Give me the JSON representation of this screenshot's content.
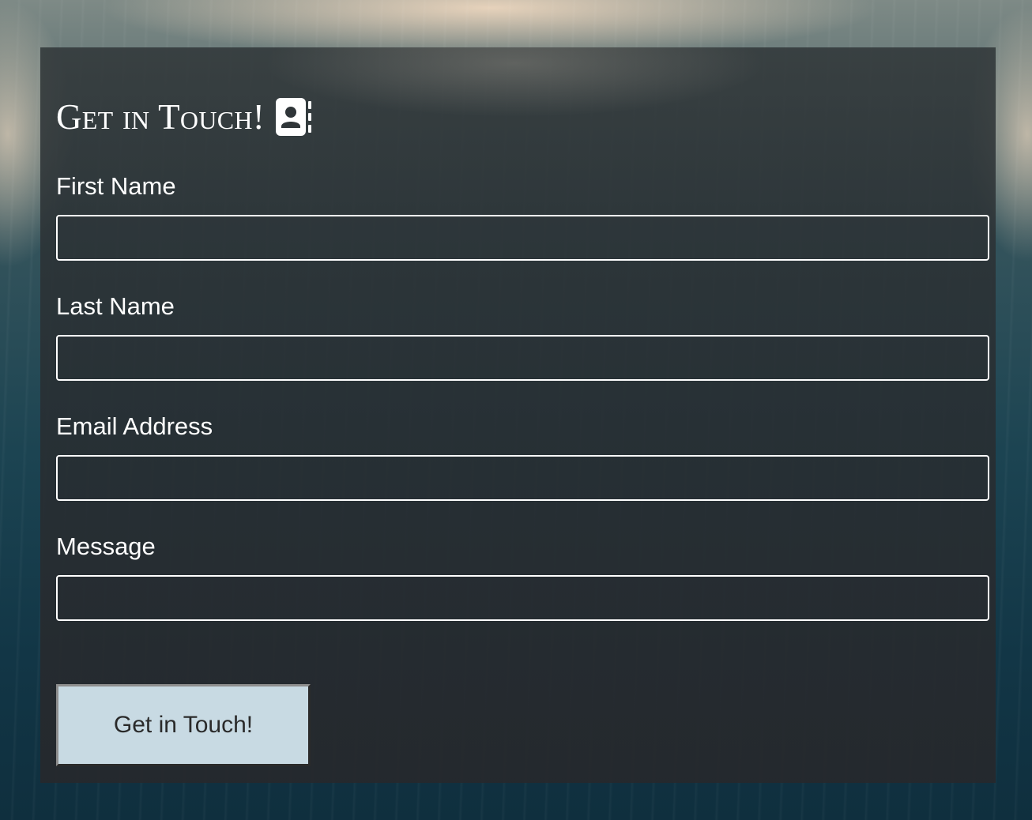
{
  "form": {
    "title": "Get in Touch!",
    "title_icon": "address-book-icon",
    "fields": [
      {
        "label": "First Name",
        "value": "",
        "placeholder": ""
      },
      {
        "label": "Last Name",
        "value": "",
        "placeholder": ""
      },
      {
        "label": "Email Address",
        "value": "",
        "placeholder": ""
      },
      {
        "label": "Message",
        "value": "",
        "placeholder": ""
      }
    ],
    "submit_label": "Get in Touch!"
  },
  "colors": {
    "panel_background": "#2f3538",
    "text": "#ffffff",
    "input_border": "#ffffff",
    "button_background": "#c8dae3",
    "button_text": "#2a2a2a"
  }
}
